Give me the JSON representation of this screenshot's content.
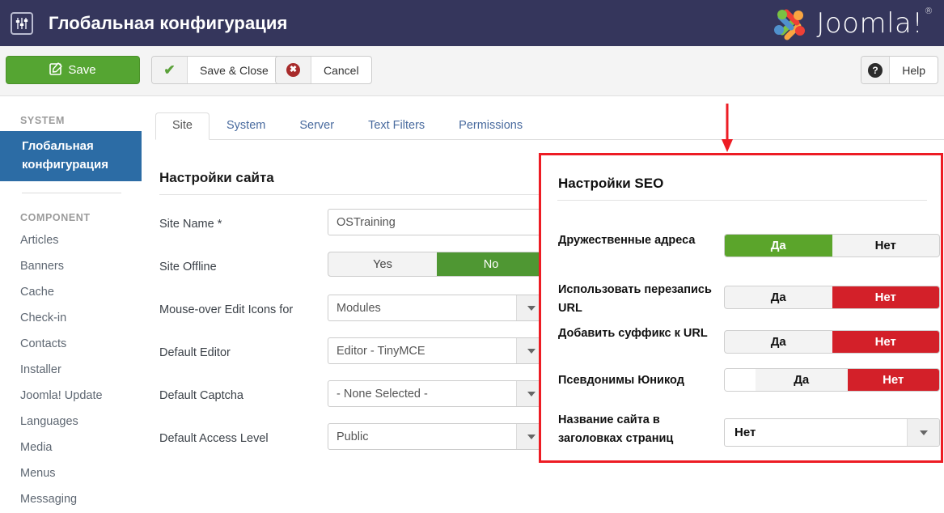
{
  "header": {
    "icon": "sliders-icon",
    "title": "Глобальная конфигурация",
    "brand": "Joomla!",
    "brand_reg": "®"
  },
  "toolbar": {
    "save_label": "Save",
    "save_icon": "pencil-square-icon",
    "save_close_label": "Save & Close",
    "save_close_icon": "check-icon",
    "cancel_label": "Cancel",
    "cancel_icon": "close-circle-icon",
    "help_label": "Help",
    "help_icon": "question-circle-icon"
  },
  "sidebar": {
    "system_heading": "SYSTEM",
    "active_item": "Глобальная конфигурация",
    "component_heading": "COMPONENT",
    "items": [
      {
        "label": "Articles"
      },
      {
        "label": "Banners"
      },
      {
        "label": "Cache"
      },
      {
        "label": "Check-in"
      },
      {
        "label": "Contacts"
      },
      {
        "label": "Installer"
      },
      {
        "label": "Joomla! Update"
      },
      {
        "label": "Languages"
      },
      {
        "label": "Media"
      },
      {
        "label": "Menus"
      },
      {
        "label": "Messaging"
      }
    ]
  },
  "tabs": [
    {
      "label": "Site",
      "active": true
    },
    {
      "label": "System",
      "active": false
    },
    {
      "label": "Server",
      "active": false
    },
    {
      "label": "Text Filters",
      "active": false
    },
    {
      "label": "Permissions",
      "active": false
    }
  ],
  "site_settings": {
    "title": "Настройки сайта",
    "rows": [
      {
        "label": "Site Name *",
        "type": "text",
        "value": "OSTraining"
      },
      {
        "label": "Site Offline",
        "type": "toggle",
        "options": [
          "Yes",
          "No"
        ],
        "selected": "No"
      },
      {
        "label": "Mouse-over Edit Icons for",
        "type": "select",
        "value": "Modules"
      },
      {
        "label": "Default Editor",
        "type": "select",
        "value": "Editor - TinyMCE"
      },
      {
        "label": "Default Captcha",
        "type": "select",
        "value": "- None Selected -"
      },
      {
        "label": "Default Access Level",
        "type": "select",
        "value": "Public"
      }
    ]
  },
  "seo_settings": {
    "title": "Настройки SEO",
    "highlight_color": "#ed1c24",
    "annotation": "red-down-arrow",
    "rows": [
      {
        "label": "Дружественные адреса",
        "type": "toggle",
        "options": [
          "Да",
          "Нет"
        ],
        "selected": "Да",
        "leading_gap": false
      },
      {
        "label": "Использовать перезапись URL",
        "type": "toggle",
        "options": [
          "Да",
          "Нет"
        ],
        "selected": "Нет",
        "leading_gap": false
      },
      {
        "label": "Добавить суффикс к URL",
        "type": "toggle",
        "options": [
          "Да",
          "Нет"
        ],
        "selected": "Нет",
        "leading_gap": false
      },
      {
        "label": "Псевдонимы Юникод",
        "type": "toggle",
        "options": [
          "Да",
          "Нет"
        ],
        "selected": "Нет",
        "leading_gap": true
      },
      {
        "label": "Название сайта в заголовках страниц",
        "type": "select",
        "value": "Нет"
      }
    ]
  },
  "colors": {
    "header_bg": "#35365c",
    "save_green": "#55a532",
    "toggle_green": "#5ba52b",
    "toggle_red": "#d32029",
    "sidebar_active": "#2c6ca5",
    "tab_link": "#486a9e",
    "highlight_red": "#ed1c24"
  }
}
